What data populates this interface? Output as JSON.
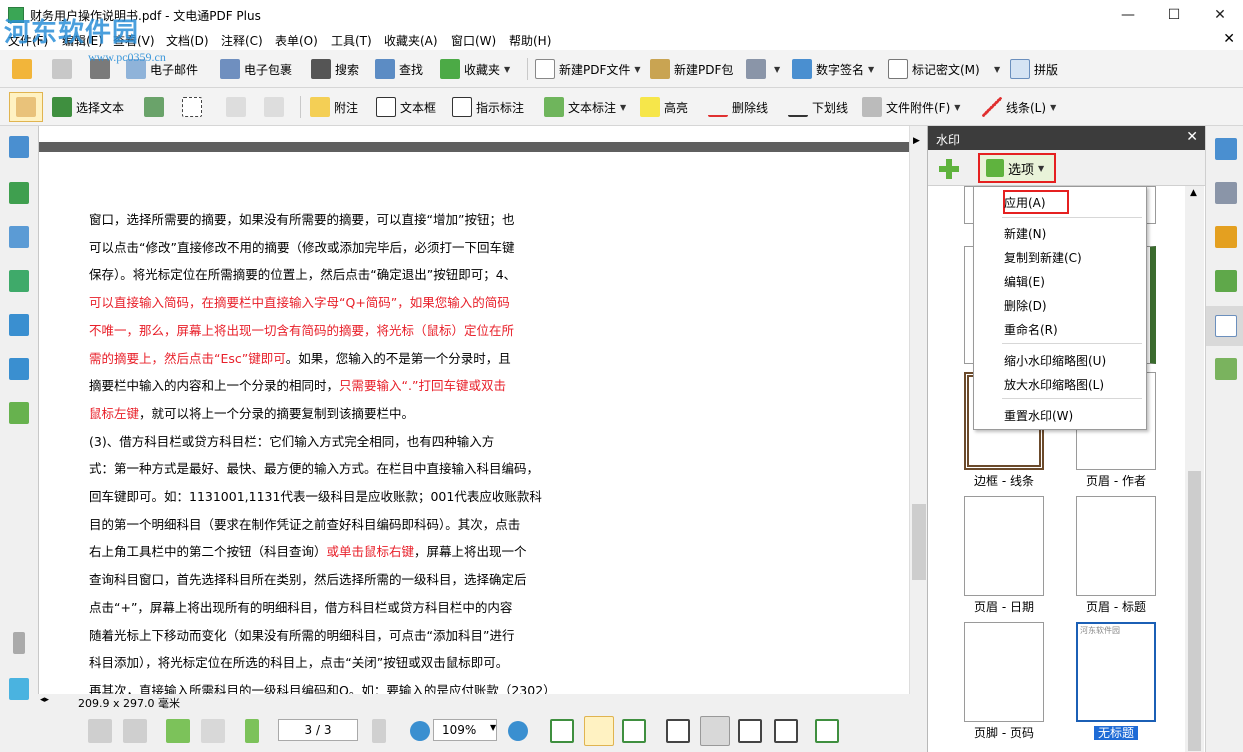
{
  "window": {
    "title": "财务用户操作说明书.pdf - 文电通PDF Plus",
    "minimize_glyph": "—",
    "maximize_glyph": "☐",
    "close_glyph": "✕"
  },
  "logo": {
    "text": "河东软件园",
    "url": "www.pc0359.cn"
  },
  "menu": {
    "items": [
      "文件(F)",
      "编辑(E)",
      "查看(V)",
      "文档(D)",
      "注释(C)",
      "表单(O)",
      "工具(T)",
      "收藏夹(A)",
      "窗口(W)",
      "帮助(H)"
    ],
    "close_glyph": "✕"
  },
  "toolbar1": {
    "email": "电子邮件",
    "envelope": "电子包裹",
    "search": "搜索",
    "find": "查找",
    "favorites": "收藏夹",
    "new_pdf": "新建PDF文件",
    "new_pdf_package": "新建PDF包",
    "sign": "数字签名",
    "mark_redact": "标记密文(M)",
    "imposition": "拼版"
  },
  "toolbar2": {
    "select_text": "选择文本",
    "note": "附注",
    "textbox": "文本框",
    "callout": "指示标注",
    "text_markup": "文本标注",
    "highlight": "高亮",
    "strikeout": "删除线",
    "underline": "下划线",
    "attachment": "文件附件(F)",
    "line": "线条(L)"
  },
  "document": {
    "lines": [
      [
        {
          "t": "窗口，选择所需要的摘要，如果没有所需要的摘要，可以直接“增加”按钮；也",
          "red": false
        }
      ],
      [
        {
          "t": "可以点击“修改”直接修改不用的摘要（修改或添加完毕后，必须打一下回车键",
          "red": false
        }
      ],
      [
        {
          "t": "保存）。将光标定位在所需摘要的位置上，然后点击“确定退出”按钮即可；4、",
          "red": false
        }
      ],
      [
        {
          "t": "可以直接输入简码，在摘要栏中直接输入字母“Q+简码”，如果您输入的简码",
          "red": true
        }
      ],
      [
        {
          "t": "不唯一，那么，屏幕上将出现一切含有简码的摘要，将光标（鼠标）定位在所",
          "red": true
        }
      ],
      [
        {
          "t": "需的摘要上，然后点击“Esc”键即可",
          "red": true
        },
        {
          "t": "。如果，您输入的不是第一个分录时，且",
          "red": false
        }
      ],
      [
        {
          "t": "摘要栏中输入的内容和上一个分录的相同时，",
          "red": false
        },
        {
          "t": "只需要输入“.”打回车键或双击",
          "red": true
        }
      ],
      [
        {
          "t": "鼠标左键",
          "red": true
        },
        {
          "t": "，就可以将上一个分录的摘要复制到该摘要栏中。",
          "red": false
        }
      ],
      [
        {
          "t": "(3)、借方科目栏或贷方科目栏：它们输入方式完全相同，也有四种输入方",
          "red": false
        }
      ],
      [
        {
          "t": "式：第一种方式是最好、最快、最方便的输入方式。在栏目中直接输入科目编码，",
          "red": false
        }
      ],
      [
        {
          "t": "回车键即可。如：1131001,1131代表一级科目是应收账款；001代表应收账款科",
          "red": false
        }
      ],
      [
        {
          "t": "目的第一个明细科目（要求在制作凭证之前查好科目编码即科码）。其次，点击",
          "red": false
        }
      ],
      [
        {
          "t": "右上角工具栏中的第二个按钮（科目查询）",
          "red": false
        },
        {
          "t": "或单击鼠标右键",
          "red": true
        },
        {
          "t": "，屏幕上将出现一个",
          "red": false
        }
      ],
      [
        {
          "t": "查询科目窗口，首先选择科目所在类别，然后选择所需的一级科目，选择确定后",
          "red": false
        }
      ],
      [
        {
          "t": "点击“+”，屏幕上将出现所有的明细科目，借方科目栏或贷方科目栏中的内容",
          "red": false
        }
      ],
      [
        {
          "t": "随着光标上下移动而变化（如果没有所需的明细科目，可点击“添加科目”进行",
          "red": false
        }
      ],
      [
        {
          "t": "科目添加），将光标定位在所选的科目上，点击“关闭”按钮或双击鼠标即可。",
          "red": false
        }
      ],
      [
        {
          "t": "再其次，直接输入所需科目的一级科目编码和Q。如：要输入的是应付账款（2302）",
          "red": false
        }
      ]
    ]
  },
  "status": {
    "page_size": "209.9 x 297.0 毫米"
  },
  "nav": {
    "page": "3 / 3",
    "zoom": "109%"
  },
  "panel": {
    "title": "水印",
    "close_glyph": "✕",
    "options_label": "选项",
    "thumbnails": [
      {
        "label": "边框 - 线条"
      },
      {
        "label": "页眉 - 作者"
      },
      {
        "label": "页眉 - 日期"
      },
      {
        "label": "页眉 - 标题"
      },
      {
        "label": "页脚 - 页码"
      },
      {
        "label": "无标题",
        "selected": true,
        "caption": "河东软件园"
      }
    ]
  },
  "dropdown": {
    "apply": "应用(A)",
    "new": "新建(N)",
    "copy_new": "复制到新建(C)",
    "edit": "编辑(E)",
    "delete": "删除(D)",
    "rename": "重命名(R)",
    "shrink": "缩小水印缩略图(U)",
    "enlarge": "放大水印缩略图(L)",
    "reset": "重置水印(W)"
  },
  "colors": {
    "accent_red": "#e8202a",
    "highlight_border": "#e52020",
    "panel_header": "#3c3c3c"
  }
}
